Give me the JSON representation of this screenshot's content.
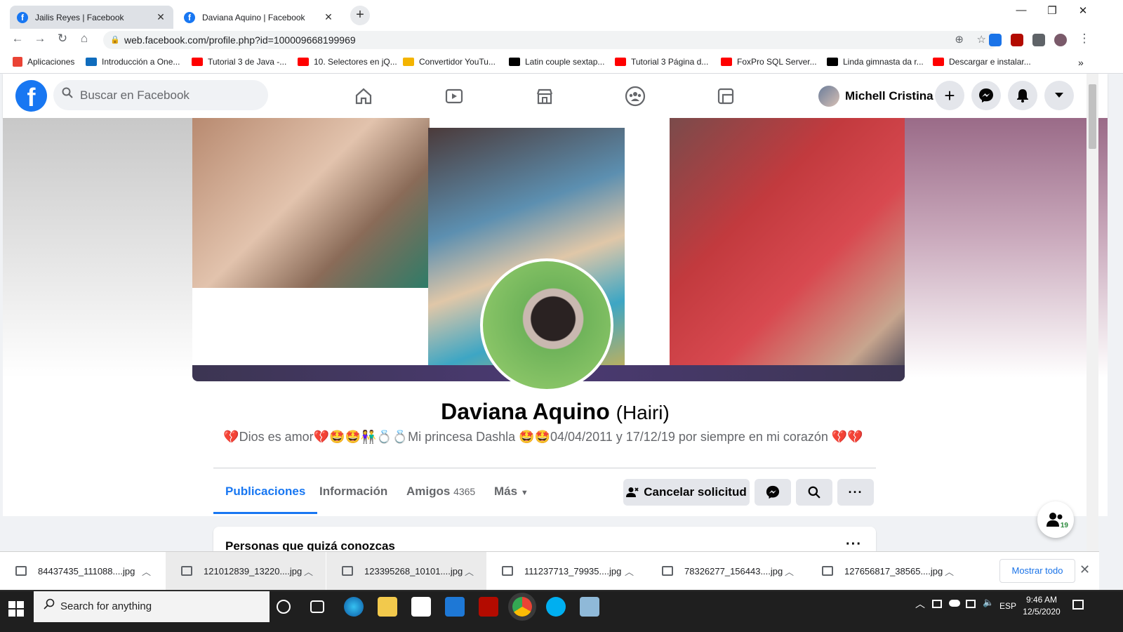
{
  "browser": {
    "tabs": [
      {
        "title": "Jailis Reyes | Facebook"
      },
      {
        "title": "Daviana Aquino | Facebook"
      }
    ],
    "url": "web.facebook.com/profile.php?id=100009668199969",
    "bookmarks": [
      {
        "label": "Aplicaciones",
        "color": "#ea4335"
      },
      {
        "label": "Introducción a One...",
        "color": "#0f6cbd"
      },
      {
        "label": "Tutorial 3 de Java -...",
        "color": "#ff0000"
      },
      {
        "label": "10. Selectores en jQ...",
        "color": "#ff0000"
      },
      {
        "label": "Convertidor YouTu...",
        "color": "#f4b400"
      },
      {
        "label": "Latin couple sextap...",
        "color": "#000000"
      },
      {
        "label": "Tutorial 3 Página d...",
        "color": "#ff0000"
      },
      {
        "label": "FoxPro SQL Server...",
        "color": "#ff0000"
      },
      {
        "label": "Linda gimnasta da r...",
        "color": "#000000"
      },
      {
        "label": "Descargar e instalar...",
        "color": "#ff0000"
      }
    ]
  },
  "facebook": {
    "logo": "f",
    "search_placeholder": "Buscar en Facebook",
    "nav_icons": [
      "home-icon",
      "watch-icon",
      "marketplace-icon",
      "groups-icon",
      "gaming-icon"
    ],
    "user_name": "Michell Cristina",
    "accent": "#1877f2"
  },
  "profile": {
    "name": "Daviana Aquino",
    "alt_name": "(Hairi)",
    "bio": "💔Dios es amor💔🤩🤩👫💍💍Mi princesa Dashla 🤩🤩04/04/2011 y 17/12/19 por siempre en mi corazón 💔💔",
    "tabs": [
      {
        "label": "Publicaciones",
        "count": ""
      },
      {
        "label": "Información",
        "count": ""
      },
      {
        "label": "Amigos",
        "count": "4365"
      },
      {
        "label": "Más",
        "count": ""
      }
    ],
    "actions": {
      "cancel_request": "Cancelar solicitud"
    },
    "card_title": "Personas que quizá conozcas",
    "card_more": "···",
    "friend_requests_badge": "19"
  },
  "downloads": {
    "items": [
      {
        "name": "84437435_111088....jpg"
      },
      {
        "name": "121012839_13220....jpg"
      },
      {
        "name": "123395268_10101....jpg"
      },
      {
        "name": "111237713_79935....jpg"
      },
      {
        "name": "78326277_156443....jpg"
      },
      {
        "name": "127656817_38565....jpg"
      }
    ],
    "show_all": "Mostrar todo"
  },
  "taskbar": {
    "search_placeholder": "Search for anything",
    "language": "ESP",
    "time": "9:46 AM",
    "date": "12/5/2020"
  }
}
